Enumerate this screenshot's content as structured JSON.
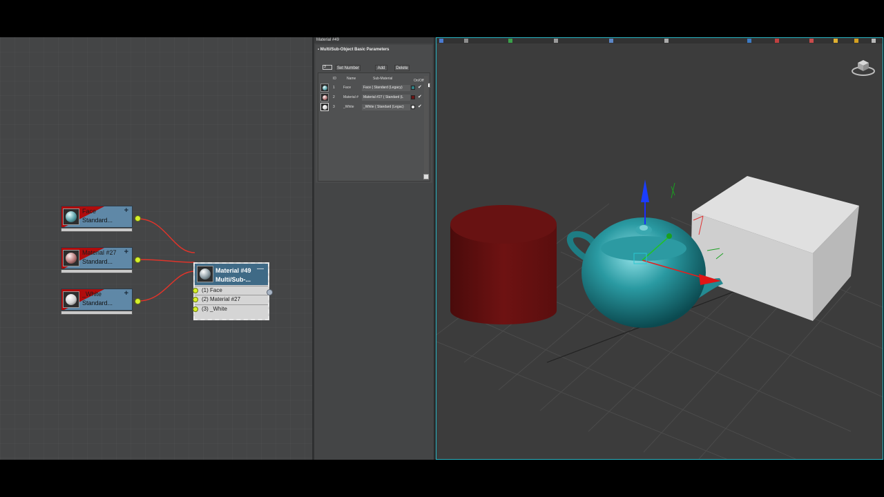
{
  "slate": {
    "nodes": [
      {
        "name": "Face",
        "type": "Standard...",
        "sphere_color": "#5aa0a8"
      },
      {
        "name": "Material #27",
        "type": "Standard...",
        "sphere_color": "#b57878"
      },
      {
        "name": "_White",
        "type": "Standard...",
        "sphere_color": "#d8d8d8"
      }
    ],
    "multi": {
      "title": "Material #49",
      "subtitle": "Multi/Sub-...",
      "minimize": "—",
      "slots": [
        "(1) Face",
        "(2) Material #27",
        "(3) _White"
      ]
    }
  },
  "panel": {
    "window_title": "Material #49",
    "rollout_title": "Multi/Sub-Object Basic Parameters",
    "set_number_value": "3",
    "buttons": {
      "set_number": "Set Number",
      "add": "Add",
      "delete": "Delete"
    },
    "headers": {
      "id": "ID",
      "name": "Name",
      "sub": "Sub-Material",
      "onoff": "On/Off"
    },
    "rows": [
      {
        "id": "1",
        "name": "Face",
        "sub": "Face  ( Standard (Legacy)",
        "color": "#2f7f84",
        "sphere": "#5aa0a8"
      },
      {
        "id": "2",
        "name": "Material #",
        "sub": "Material #27  ( Standard (L",
        "color": "#6b1414",
        "sphere": "#b57878"
      },
      {
        "id": "3",
        "name": "_White",
        "sub": "_White  ( Standard (Legac)",
        "color": "#e2e2e2",
        "sphere": "#d8d8d8"
      }
    ],
    "check": "✔"
  },
  "viewport": {
    "accent": "#2ab7c6",
    "objects": [
      "cylinder",
      "teapot",
      "box"
    ]
  }
}
